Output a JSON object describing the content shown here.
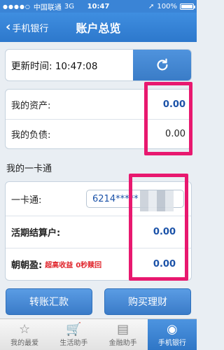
{
  "status": {
    "carrier": "中国联通",
    "network": "3G",
    "time": "10:47",
    "battery": "100%"
  },
  "nav": {
    "back_label": "手机银行",
    "title": "账户总览"
  },
  "update": {
    "text": "更新时间: 10:47:08"
  },
  "assets": {
    "my_assets_label": "我的资产:",
    "my_assets_value": "0.00",
    "my_debt_label": "我的负债:",
    "my_debt_value": "0.00"
  },
  "section": {
    "title": "我的一卡通"
  },
  "card": {
    "card_label": "一卡通:",
    "card_number": "6214*****",
    "demand_label": "活期结算户:",
    "demand_value": "0.00",
    "zhaozhao_label": "朝朝盈:",
    "zhaozhao_promo_1": "超高收益",
    "zhaozhao_promo_2": "0秒赎回",
    "zhaozhao_value": "0.00"
  },
  "buttons": {
    "transfer": "转账汇款",
    "buy": "购买理财"
  },
  "tabs": [
    {
      "label": "我的最爱",
      "icon": "star-icon"
    },
    {
      "label": "生活助手",
      "icon": "cart-icon"
    },
    {
      "label": "金融助手",
      "icon": "finance-icon"
    },
    {
      "label": "手机银行",
      "icon": "bank-icon"
    }
  ]
}
